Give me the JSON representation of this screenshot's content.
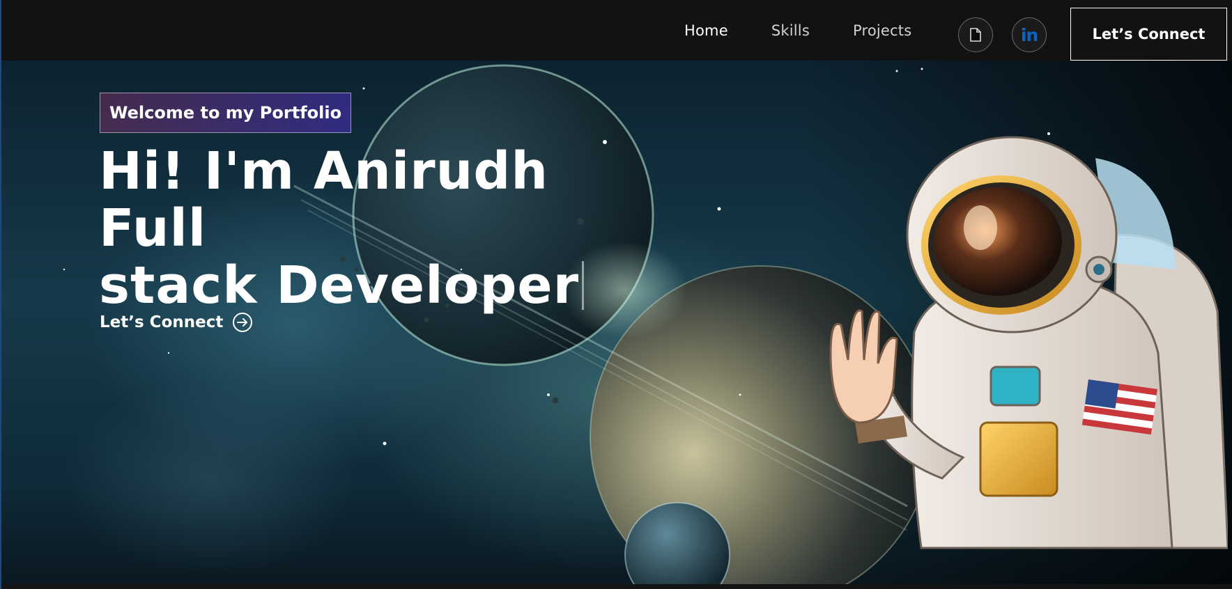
{
  "nav": {
    "links": [
      {
        "label": "Home"
      },
      {
        "label": "Skills"
      },
      {
        "label": "Projects"
      }
    ],
    "icons": {
      "resume": "document-icon",
      "linkedin": "linkedin-icon",
      "linkedin_text": "in"
    },
    "cta_label": "Let’s Connect"
  },
  "hero": {
    "tagline": "Welcome to my Portfolio",
    "headline_line1": "Hi! I'm Anirudh Full",
    "headline_line2": "stack Developer",
    "cta_label": "Let’s Connect"
  },
  "colors": {
    "navbar_bg": "#121212",
    "accent_blue": "#0a66c2",
    "tagline_gradient": [
      "#aa367c",
      "#4a2fbd"
    ]
  }
}
